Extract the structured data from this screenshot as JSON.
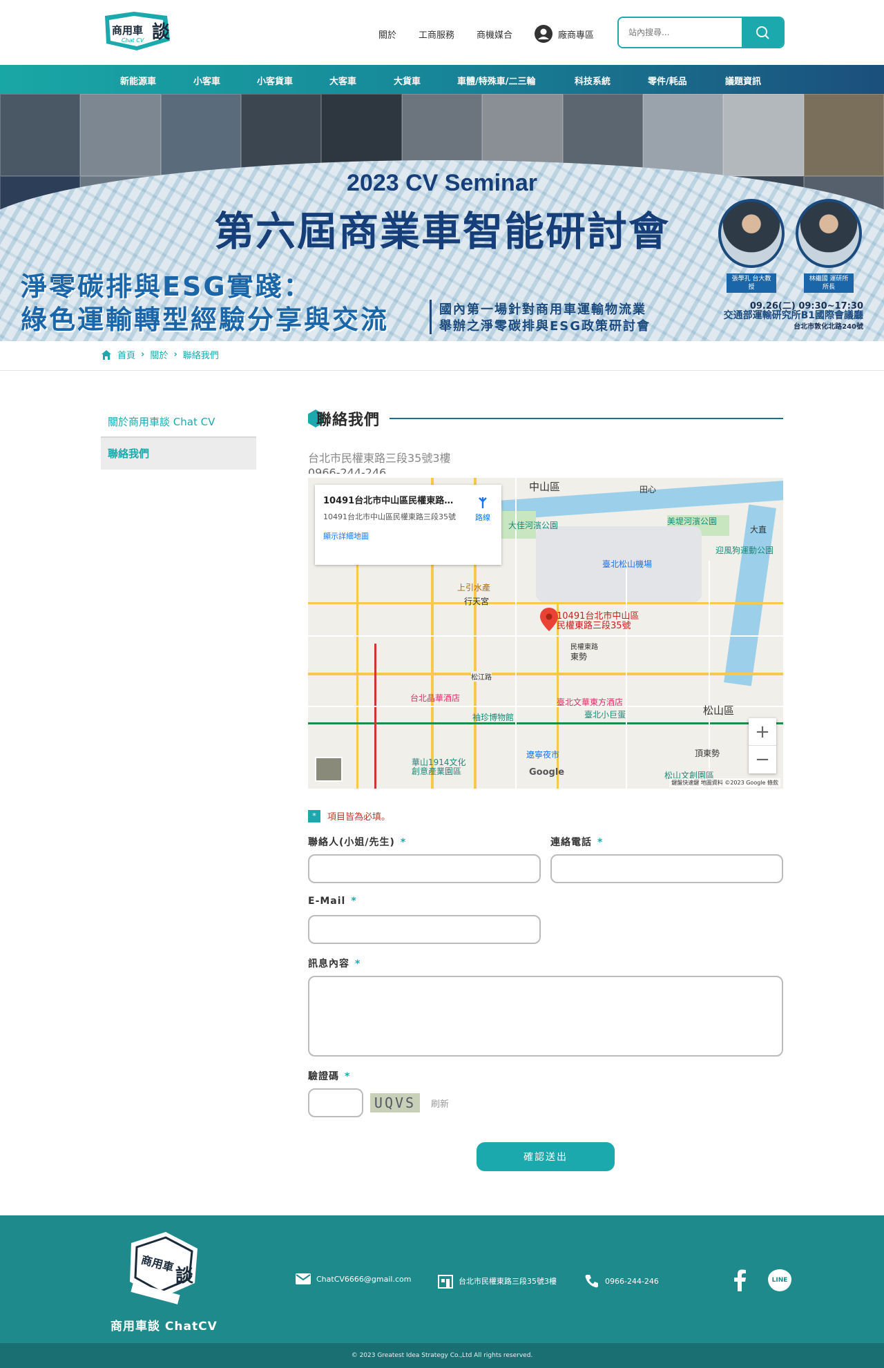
{
  "header": {
    "logo_text": "商用車談",
    "logo_sub": "Chat CV",
    "nav": [
      "關於",
      "工商服務",
      "商機媒合"
    ],
    "vendor_label": "廠商專區",
    "search_placeholder": "站內搜尋..."
  },
  "main_nav": [
    "新能源車",
    "小客車",
    "小客貨車",
    "大客車",
    "大貨車",
    "車體/特殊車/二三輪",
    "科技系統",
    "零件/耗品",
    "議題資訊"
  ],
  "banner": {
    "title1": "2023 CV Seminar",
    "title2": "第六屆商業車智能研討會",
    "left1": "淨零碳排與ESG實踐：",
    "left2": "綠色運輸轉型經驗分享與交流",
    "mid1": "國內第一場針對商用車運輸物流業",
    "mid2": "舉辦之淨零碳排與ESG政策研討會",
    "speaker1": "張學孔 台大教授",
    "speaker2": "林繼國 運研所所長",
    "date": "09.26(二) 09:30~17:30",
    "venue": "交通部運輸研究所B1國際會議廳",
    "address": "台北市敦化北路240號"
  },
  "breadcrumb": [
    "首頁",
    "關於",
    "聯絡我們"
  ],
  "sidebar": [
    "關於商用車談 Chat CV",
    "聯絡我們"
  ],
  "content": {
    "title": "聯絡我們",
    "address": "台北市民權東路三段35號3樓",
    "phone": "0966-244-246"
  },
  "map": {
    "info_title": "10491台北市中山區民權東路...",
    "info_address": "10491台北市中山區民權東路三段35號",
    "info_link": "顯示詳細地圖",
    "directions": "路線",
    "pin_label_1": "10491台北市中山區",
    "pin_label_2": "民權東路三段35號",
    "labels": [
      "中山區",
      "大佳河濱公園",
      "美堤河濱公園",
      "迎風狗運動公園",
      "臺北松山機場",
      "上引水產",
      "行天宮",
      "台北晶華酒店",
      "臺北文華東方酒店",
      "臺北小巨蛋",
      "袖珍博物館",
      "遼寧夜市",
      "華山1914文化創意產業園區",
      "松山區",
      "松山文創園區",
      "東勢",
      "頂東勢",
      "大直",
      "田心",
      "民權東路",
      "松江路"
    ],
    "footer": "鍵盤快速鍵  地圖資料 ©2023 Google  條款",
    "google": "Google"
  },
  "form": {
    "required_note": "項目皆為必填。",
    "contact_label": "聯絡人(小姐/先生)",
    "phone_label": "連絡電話",
    "email_label": "E-Mail",
    "message_label": "訊息內容",
    "captcha_label": "驗證碼",
    "captcha_code": "UQVS",
    "refresh": "刷新",
    "submit": "確認送出",
    "asterisk": "*"
  },
  "footer": {
    "brand": "商用車談 ChatCV",
    "email": "ChatCV6666@gmail.com",
    "address": "台北市民權東路三段35號3樓",
    "phone": "0966-244-246",
    "line": "LINE",
    "copyright": "© 2023 Greatest Idea Strategy Co.,Ltd All rights reserved."
  },
  "colors": {
    "accent": "#1ba9ad",
    "footer": "#1f8a8c",
    "navy": "#1b4f7c"
  }
}
